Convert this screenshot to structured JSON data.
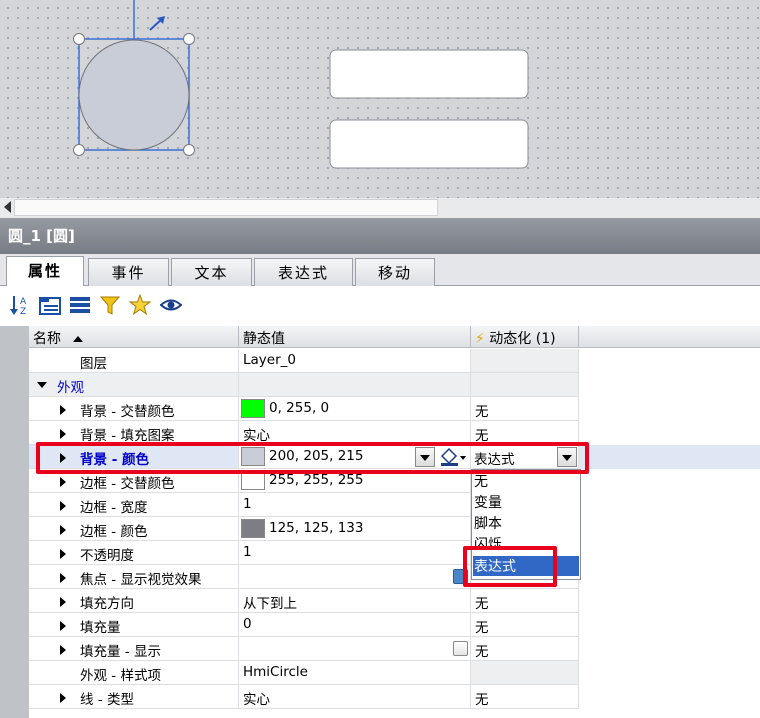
{
  "window_title": "圆_1 [圆]",
  "tabs": [
    {
      "label": "属性",
      "active": true
    },
    {
      "label": "事件",
      "active": false
    },
    {
      "label": "文本",
      "active": false
    },
    {
      "label": "表达式",
      "active": false
    },
    {
      "label": "移动",
      "active": false
    }
  ],
  "toolbar_icons": [
    "sort-az-icon",
    "expand-all-icon",
    "collapse-all-icon",
    "filter-icon",
    "star-icon",
    "eye-icon"
  ],
  "columns": {
    "name": "名称",
    "static": "静态值",
    "dynamic": "动态化 (1)"
  },
  "rows": [
    {
      "name": "图层",
      "value": "Layer_0",
      "dynamic": ""
    },
    {
      "name": "外观",
      "value": "",
      "dynamic": ""
    },
    {
      "name": "背景 - 交替颜色",
      "value": "0, 255, 0",
      "color": "#00ff00",
      "dynamic": "无"
    },
    {
      "name": "背景 - 填充图案",
      "value": "实心",
      "dynamic": "无"
    },
    {
      "name": "背景 - 颜色",
      "value": "200, 205, 215",
      "color": "#c8cdd7",
      "dynamic": "表达式"
    },
    {
      "name": "边框 - 交替颜色",
      "value": "255, 255, 255",
      "color": "#ffffff",
      "dynamic": ""
    },
    {
      "name": "边框 - 宽度",
      "value": "1",
      "dynamic": ""
    },
    {
      "name": "边框 - 颜色",
      "value": "125, 125, 133",
      "color": "#7d7d85",
      "dynamic": ""
    },
    {
      "name": "不透明度",
      "value": "1",
      "dynamic": ""
    },
    {
      "name": "焦点 - 显示视觉效果",
      "value": "",
      "dynamic": ""
    },
    {
      "name": "填充方向",
      "value": "从下到上",
      "dynamic": "无"
    },
    {
      "name": "填充量",
      "value": "0",
      "dynamic": "无"
    },
    {
      "name": "填充量 - 显示",
      "value": "",
      "dynamic": "无"
    },
    {
      "name": "外观 - 样式项",
      "value": "HmiCircle",
      "dynamic": ""
    },
    {
      "name": "线 - 类型",
      "value": "实心",
      "dynamic": "无"
    }
  ],
  "dropdown_options": [
    "无",
    "变量",
    "脚本",
    "闪烁",
    "表达式"
  ],
  "colors": {
    "accent": "#3168c6",
    "highlight": "#e8001c",
    "link": "#0000cc"
  }
}
